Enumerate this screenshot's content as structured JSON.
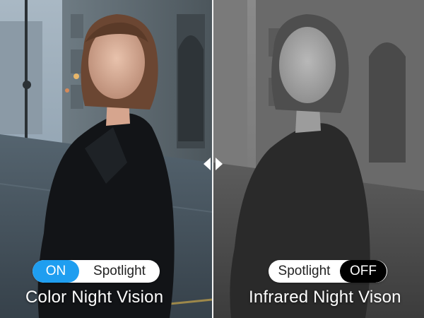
{
  "left_panel": {
    "mode": "color",
    "toggle": {
      "state_label": "ON",
      "feature_label": "Spotlight",
      "state_color": "#1f9ef0"
    },
    "caption": "Color Night Vision"
  },
  "right_panel": {
    "mode": "infrared",
    "toggle": {
      "feature_label": "Spotlight",
      "state_label": "OFF",
      "state_color": "#000000"
    },
    "caption": "Infrared Night Vison"
  },
  "divider": {
    "handle_icons": [
      "chevron-left-icon",
      "chevron-right-icon"
    ],
    "color": "#f2f2f2"
  }
}
